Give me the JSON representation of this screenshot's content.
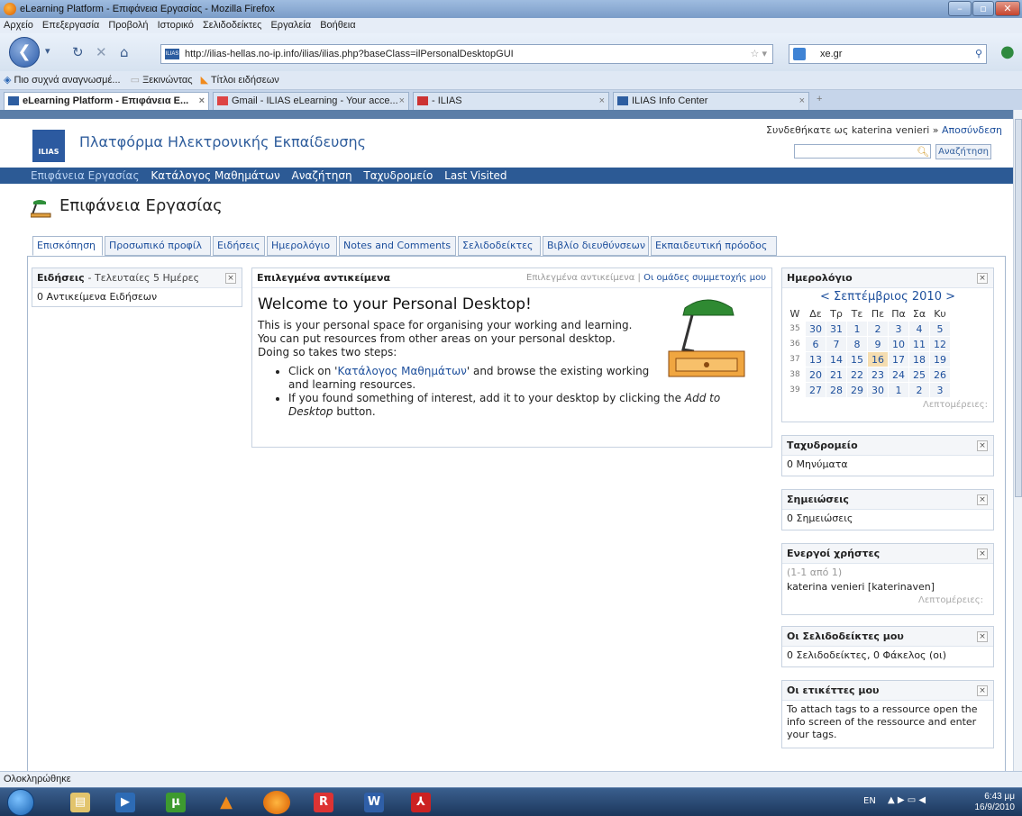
{
  "window": {
    "title": "eLearning Platform - Επιφάνεια Εργασίας - Mozilla Firefox"
  },
  "menubar": [
    "Αρχείο",
    "Επεξεργασία",
    "Προβολή",
    "Ιστορικό",
    "Σελιδοδείκτες",
    "Εργαλεία",
    "Βοήθεια"
  ],
  "navbar": {
    "url": "http://ilias-hellas.no-ip.info/ilias/ilias.php?baseClass=ilPersonalDesktopGUI",
    "search": "xe.gr"
  },
  "bookmarks": [
    "Πιο συχνά αναγνωσμέ...",
    "Ξεκινώντας",
    "Τίτλοι ειδήσεων"
  ],
  "tabs": [
    {
      "label": "eLearning Platform - Επιφάνεια Ε..."
    },
    {
      "label": "Gmail - ILIAS eLearning - Your acce..."
    },
    {
      "label": "- ILIAS"
    },
    {
      "label": "ILIAS Info Center"
    }
  ],
  "ilias": {
    "logo": "ILIAS",
    "title": "Πλατφόρμα Ηλεκτρονικής Εκπαίδευσης",
    "login_text": "Συνδεθήκατε ως katerina venieri »",
    "logout": "Αποσύνδεση",
    "search_button": "Αναζήτηση",
    "mainmenu": [
      "Επιφάνεια Εργασίας",
      "Κατάλογος Μαθημάτων",
      "Αναζήτηση",
      "Ταχυδρομείο",
      "Last Visited"
    ],
    "page_title": "Επιφάνεια Εργασίας",
    "tabs": [
      "Επισκόπηση",
      "Προσωπικό προφίλ",
      "Ειδήσεις",
      "Ημερολόγιο",
      "Notes and Comments",
      "Σελιδοδείκτες",
      "Βιβλίο διευθύνσεων",
      "Εκπαιδευτική πρόοδος"
    ]
  },
  "news": {
    "title": "Ειδήσεις",
    "subtitle": "- Τελευταίες 5 Ημέρες",
    "body": "0 Αντικείμενα Ειδήσεων"
  },
  "selected": {
    "title": "Επιλεγμένα αντικείμενα",
    "link1": "Επιλεγμένα αντικείμενα",
    "sep": "|",
    "link2": "Οι ομάδες συμμετοχής μου",
    "welcome": "Welcome to your Personal Desktop!",
    "p1": "This is your personal space for organising your working and learning.",
    "p2": "You can put resources from other areas on your personal desktop.",
    "p3": "Doing so takes two steps:",
    "b1_pre": "Click on '",
    "b1_link": "Κατάλογος Μαθημάτων",
    "b1_post": "' and browse the existing working and learning resources.",
    "b2_pre": "If you found something of interest, add it to your desktop by clicking the ",
    "b2_em": "Add to Desktop",
    "b2_post": " button."
  },
  "calendar": {
    "title": "Ημερολόγιο",
    "month": "< Σεπτέμβριος 2010 >",
    "wk": "W",
    "days": [
      "Δε",
      "Τρ",
      "Τε",
      "Πε",
      "Πα",
      "Σα",
      "Κυ"
    ],
    "rows": [
      {
        "w": "35",
        "d": [
          "30",
          "31",
          "1",
          "2",
          "3",
          "4",
          "5"
        ]
      },
      {
        "w": "36",
        "d": [
          "6",
          "7",
          "8",
          "9",
          "10",
          "11",
          "12"
        ]
      },
      {
        "w": "37",
        "d": [
          "13",
          "14",
          "15",
          "16",
          "17",
          "18",
          "19"
        ]
      },
      {
        "w": "38",
        "d": [
          "20",
          "21",
          "22",
          "23",
          "24",
          "25",
          "26"
        ]
      },
      {
        "w": "39",
        "d": [
          "27",
          "28",
          "29",
          "30",
          "1",
          "2",
          "3"
        ]
      }
    ],
    "details": "Λεπτομέρειες:"
  },
  "mail": {
    "title": "Ταχυδρομείο",
    "body": "0 Μηνύματα"
  },
  "notes": {
    "title": "Σημειώσεις",
    "body": "0 Σημειώσεις"
  },
  "users": {
    "title": "Ενεργοί χρήστες",
    "count": "(1-1 από 1)",
    "body": "katerina venieri [katerinaven]",
    "details": "Λεπτομέρειες:"
  },
  "bookmarksblock": {
    "title": "Οι Σελιδοδείκτες μου",
    "body": "0 Σελιδοδείκτες, 0 Φάκελος (οι)"
  },
  "tagsblock": {
    "title": "Οι ετικέττες μου",
    "body": "To attach tags to a ressource open the info screen of the ressource and enter your tags."
  },
  "status": "Ολοκληρώθηκε",
  "tray": {
    "lang": "EN",
    "time": "6:43 μμ",
    "date": "16/9/2010"
  }
}
